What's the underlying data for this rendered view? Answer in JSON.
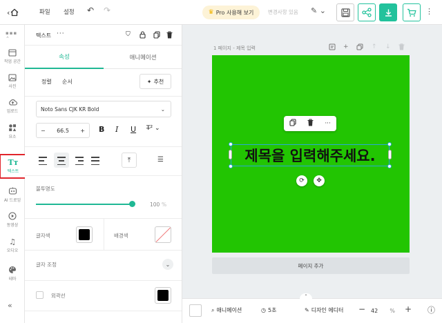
{
  "topbar": {
    "menu_file": "파일",
    "menu_settings": "설정",
    "pro_label": "Pro 사용해 보기",
    "save_status": "변경사항 있음"
  },
  "rail": {
    "items": [
      {
        "label": "작업 공간",
        "icon": "workspace-icon"
      },
      {
        "label": "사진",
        "icon": "image-icon"
      },
      {
        "label": "업로드",
        "icon": "upload-icon"
      },
      {
        "label": "요소",
        "icon": "elements-icon"
      },
      {
        "label": "텍스트",
        "icon": "text-icon",
        "active": true
      },
      {
        "label": "AI 드로잉",
        "icon": "ai-drawing-icon"
      },
      {
        "label": "동영상",
        "icon": "video-icon"
      },
      {
        "label": "오디오",
        "icon": "audio-icon"
      },
      {
        "label": "테마",
        "icon": "palette-icon"
      }
    ]
  },
  "panel": {
    "title": "텍스트",
    "tabs": [
      "속성",
      "애니메이션"
    ],
    "align_label": "정렬",
    "order_label": "순서",
    "recommend_label": "추천",
    "font_name": "Noto Sans CJK KR Bold",
    "font_size": "66.5",
    "opacity_label": "불투명도",
    "opacity_value": "100",
    "opacity_unit": "%",
    "text_color_label": "글자색",
    "bg_color_label": "배경색",
    "adjust_label": "글자 조정",
    "outline_label": "외곽선"
  },
  "canvas": {
    "page_label": "1 페이지 - 제목 입력",
    "text": "제목을 입력해주세요.",
    "add_page_label": "페이지 추가",
    "page_color": "#22c502"
  },
  "bottombar": {
    "animation_label": "애니메이션",
    "duration_label": "5초",
    "designer_label": "디자인 에디터",
    "zoom_value": "42",
    "zoom_unit": "%"
  },
  "colors": {
    "accent": "#1fb894",
    "active_outline": "#e0242b",
    "pro_bg": "#fdf3d7"
  }
}
